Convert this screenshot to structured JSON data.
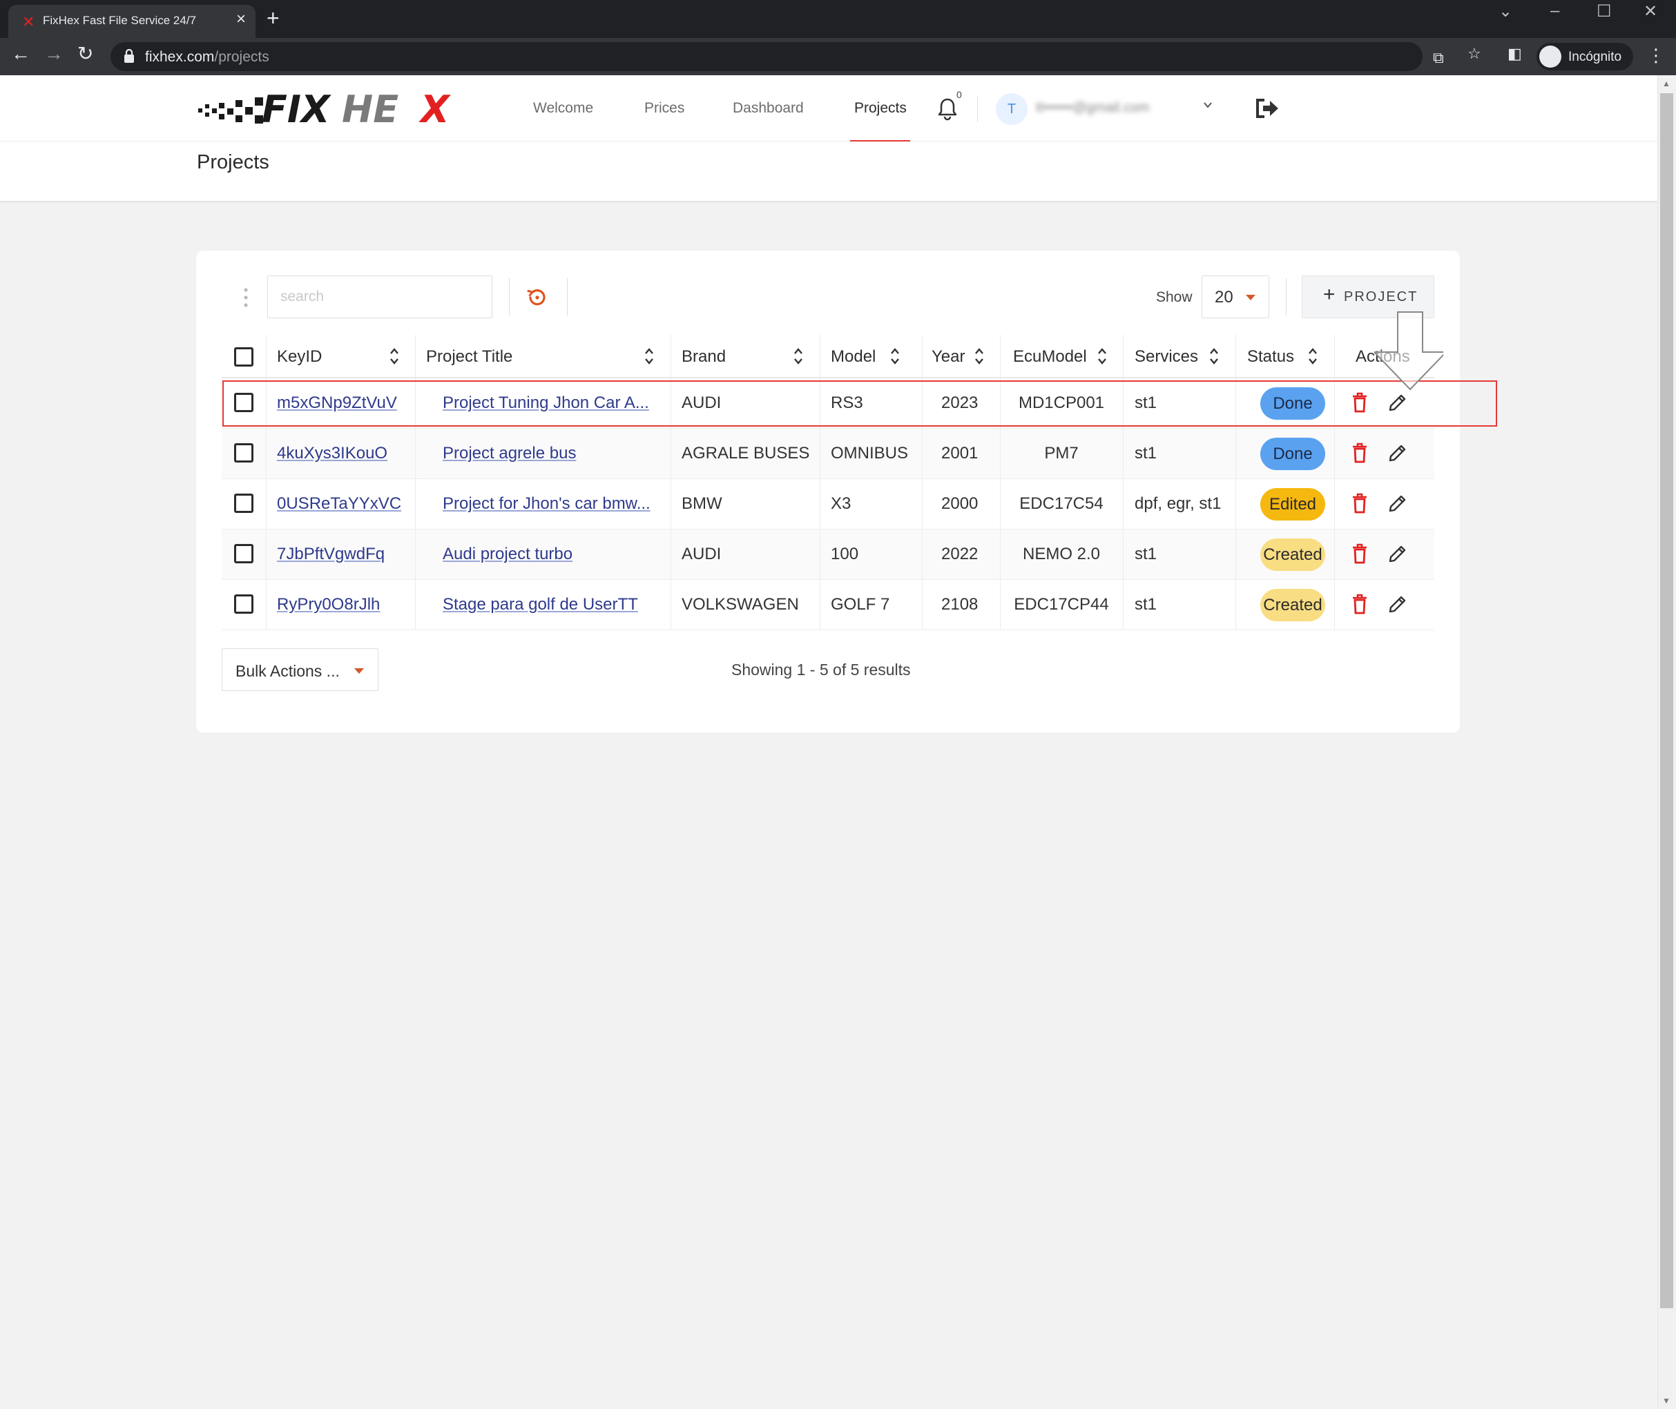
{
  "browser": {
    "tab_title": "FixHex Fast File Service 24/7",
    "url_domain": "fixhex.com",
    "url_path": "/projects",
    "incognito_label": "Incógnito"
  },
  "header": {
    "brand": "FIXHEX",
    "nav": [
      "Welcome",
      "Prices",
      "Dashboard",
      "Projects"
    ],
    "active_nav": "Projects",
    "notification_count": "0",
    "user_initial": "T",
    "user_email": "tt••••••@gmail.com"
  },
  "page": {
    "title": "Projects"
  },
  "toolbar": {
    "search_placeholder": "search",
    "show_label": "Show",
    "page_size": "20",
    "add_project_label": "PROJECT"
  },
  "table": {
    "columns": [
      "KeyID",
      "Project Title",
      "Brand",
      "Model",
      "Year",
      "EcuModel",
      "Services",
      "Status",
      "Actions"
    ],
    "rows": [
      {
        "key_id": "m5xGNp9ZtVuV",
        "title": "Project Tuning Jhon Car A...",
        "brand": "AUDI",
        "model": "RS3",
        "year": "2023",
        "ecu": "MD1CP001",
        "services": "st1",
        "status": "Done"
      },
      {
        "key_id": "4kuXys3IKouO",
        "title": "Project agrele bus",
        "brand": "AGRALE BUSES",
        "model": "OMNIBUS",
        "year": "2001",
        "ecu": "PM7",
        "services": "st1",
        "status": "Done"
      },
      {
        "key_id": "0USReTaYYxVC",
        "title": "Project for Jhon's car bmw...",
        "brand": "BMW",
        "model": "X3",
        "year": "2000",
        "ecu": "EDC17C54",
        "services": "dpf, egr, st1",
        "status": "Edited"
      },
      {
        "key_id": "7JbPftVgwdFq",
        "title": "Audi project turbo",
        "brand": "AUDI",
        "model": "100",
        "year": "2022",
        "ecu": "NEMO 2.0",
        "services": "st1",
        "status": "Created"
      },
      {
        "key_id": "RyPry0O8rJlh",
        "title": "Stage para golf de UserTT",
        "brand": "VOLKSWAGEN",
        "model": "GOLF 7",
        "year": "2108",
        "ecu": "EDC17CP44",
        "services": "st1",
        "status": "Created"
      }
    ]
  },
  "footer": {
    "bulk_actions_label": "Bulk Actions ...",
    "showing_text": "Showing 1 - 5 of 5 results"
  },
  "colors": {
    "accent_red": "#e53935",
    "status_done": "#5aa2f0",
    "status_edited": "#f5b80f",
    "status_created": "#f8dd82"
  }
}
